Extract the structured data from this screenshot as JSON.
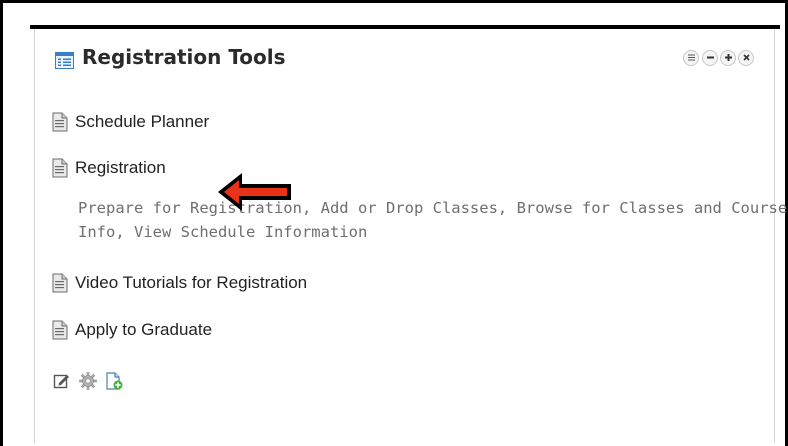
{
  "portlet": {
    "title": "Registration Tools",
    "title_icon": "portlet-icon",
    "controls": [
      {
        "name": "menu",
        "icon": "menu-icon",
        "glyph": "☰"
      },
      {
        "name": "minimize",
        "icon": "minimize-icon",
        "glyph": "−"
      },
      {
        "name": "maximize",
        "icon": "maximize-icon",
        "glyph": "+"
      },
      {
        "name": "close",
        "icon": "close-icon",
        "glyph": "×"
      }
    ]
  },
  "items": [
    {
      "label": "Schedule Planner",
      "icon": "document-icon"
    },
    {
      "label": "Registration",
      "icon": "document-icon"
    },
    {
      "label": "Video Tutorials for Registration",
      "icon": "document-icon"
    },
    {
      "label": "Apply to Graduate",
      "icon": "document-icon"
    }
  ],
  "registration_description": {
    "line1": "Prepare for Registration, Add or Drop Classes, Browse for Classes and Course",
    "line2": "Info, View Schedule Information"
  },
  "footer_tools": [
    {
      "name": "edit",
      "icon": "edit-icon"
    },
    {
      "name": "settings",
      "icon": "gear-icon"
    },
    {
      "name": "add-document",
      "icon": "add-document-icon"
    }
  ],
  "colors": {
    "title_text": "#2b2b2b",
    "link_text": "#222222",
    "description_text": "#6f6f6f",
    "arrow_fill": "#e8321a",
    "border": "#000000"
  }
}
